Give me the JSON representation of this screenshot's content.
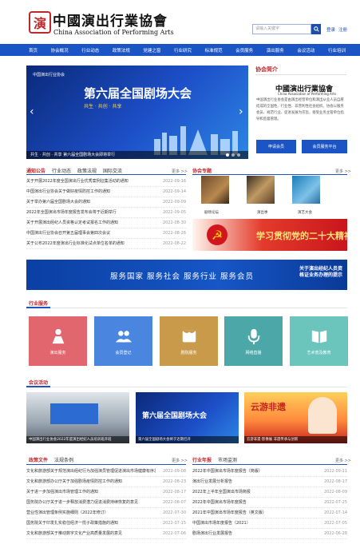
{
  "header": {
    "logo_seal": "演",
    "logo_cn": "中國演出行業協會",
    "logo_en": "China Association of Performing Arts",
    "search_placeholder": "请输入关键字",
    "search_icon": "search-icon",
    "links": [
      "登录",
      "注册"
    ]
  },
  "nav": [
    "首页",
    "协会概况",
    "行业动态",
    "政策法规",
    "党建之窗",
    "行业研究",
    "标准规范",
    "会员服务",
    "演出服务",
    "会议活动",
    "行业培训"
  ],
  "hero": {
    "logo": "中国演出行业协会",
    "title": "第六届全国剧场大会",
    "subtitle": "共生 · 共创 · 共享",
    "caption": "共生 · 共创 · 共享 第六届全国剧场大会即将举行"
  },
  "assoc": {
    "title": "协会简介",
    "name_cn": "中國演出行業協會",
    "name_en": "China Association of Performing Arts",
    "text": "中国演出行业协会是由演出经营单位和演出从业人员自愿结成的全国性、行业性、非营利性社会组织。协会以服务会员、规范行业、促进发展为宗旨，接受业务主管单位指导和监督管理。",
    "buttons": [
      "申请会员",
      "会员服务平台"
    ]
  },
  "notices": {
    "tabs": [
      "通知公告",
      "行业动态",
      "政策法规",
      "国际交流"
    ],
    "more": "更多 >>",
    "items": [
      {
        "title": "关于开展2022年度全国演出行业优秀案例征集活动的通知",
        "date": "2022-09-16"
      },
      {
        "title": "中国演出行业协会关于做好疫情防控工作的通知",
        "date": "2022-09-14"
      },
      {
        "title": "关于举办第六届全国剧场大会的通知",
        "date": "2022-09-09"
      },
      {
        "title": "2022年全国演出市场年度报告发布会将于近期举行",
        "date": "2022-09-05"
      },
      {
        "title": "关于开展演出经纪人员资格认定考试报名工作的通知",
        "date": "2022-08-30"
      },
      {
        "title": "中国演出行业协会召开第五届理事会第四次会议",
        "date": "2022-08-26"
      },
      {
        "title": "关于公布2022年度演出行业标准化试点单位名单的通知",
        "date": "2022-08-22"
      }
    ]
  },
  "topic": {
    "title": "协会专题",
    "more": "更多 >>",
    "thumbs": [
      "剧场论坛",
      "演出季",
      "演艺大会"
    ],
    "party_text": "学习贯彻党的二十大精神",
    "party_emblem": "☭"
  },
  "wide_banner": {
    "left": "服务国家  服务社会  服务行业  服务会员",
    "right": "关于演出经纪人员资格证业务办理的提示"
  },
  "services": {
    "title": "行业服务",
    "tiles": [
      {
        "label": "演出服务",
        "icon": "performer-icon",
        "color": "#e2666d"
      },
      {
        "label": "会员登记",
        "icon": "members-icon",
        "color": "#4a86e0"
      },
      {
        "label": "剧院服务",
        "icon": "theater-icon",
        "color": "#c89a4a"
      },
      {
        "label": "网络直播",
        "icon": "microphone-icon",
        "color": "#4ba7a8"
      },
      {
        "label": "艺术普及教育",
        "icon": "book-icon",
        "color": "#6cc5bd"
      }
    ]
  },
  "gallery": {
    "title": "会议活动",
    "items": [
      "中国演出行业协会2022年度演出经纪人员培训班开班",
      "第六届全国剧场大会将于近期召开",
      "云游非遗·影像展 非遗传承与创新"
    ],
    "third_title": "云游非遗"
  },
  "policy": {
    "tabs": [
      "政策文件",
      "法规条例"
    ],
    "more": "更多 >>",
    "items": [
      {
        "title": "文化和旅游部关于规范演出经纪行为加强演员管理促进演出市场健康有序发展的通知",
        "date": "2022-09-08"
      },
      {
        "title": "文化和旅游部办公厅关于加强剧场疫情防控工作的通知",
        "date": "2022-08-23"
      },
      {
        "title": "关于进一步加强演出市场管理工作的通知",
        "date": "2022-08-17"
      },
      {
        "title": "国务院办公厅关于进一步释放消费潜力促进消费持续恢复的意见",
        "date": "2022-08-07"
      },
      {
        "title": "营业性演出管理条例实施细则（2022年修订）",
        "date": "2022-07-30"
      },
      {
        "title": "国务院关于印发扎实稳住经济一揽子政策措施的通知",
        "date": "2022-07-15"
      },
      {
        "title": "文化和旅游部关于推动数字文化产业高质量发展的意见",
        "date": "2022-07-06"
      }
    ]
  },
  "standards": {
    "tabs": [
      "行业年报",
      "市场监测"
    ],
    "more": "更多 >>",
    "items": [
      {
        "title": "2022年中国演出市场年度报告（简版）",
        "date": "2022-09-11"
      },
      {
        "title": "演出行业发展分析报告",
        "date": "2022-08-17"
      },
      {
        "title": "2022年上半年全国演出市场简报",
        "date": "2022-08-09"
      },
      {
        "title": "2022年中国演出市场年度报告",
        "date": "2022-07-25"
      },
      {
        "title": "2021年中国演出市场年度报告（英文版）",
        "date": "2022-07-14"
      },
      {
        "title": "中国演出市场年度报告（2021）",
        "date": "2022-07-05"
      },
      {
        "title": "剧场演出行业发展报告",
        "date": "2022-06-28"
      }
    ]
  }
}
